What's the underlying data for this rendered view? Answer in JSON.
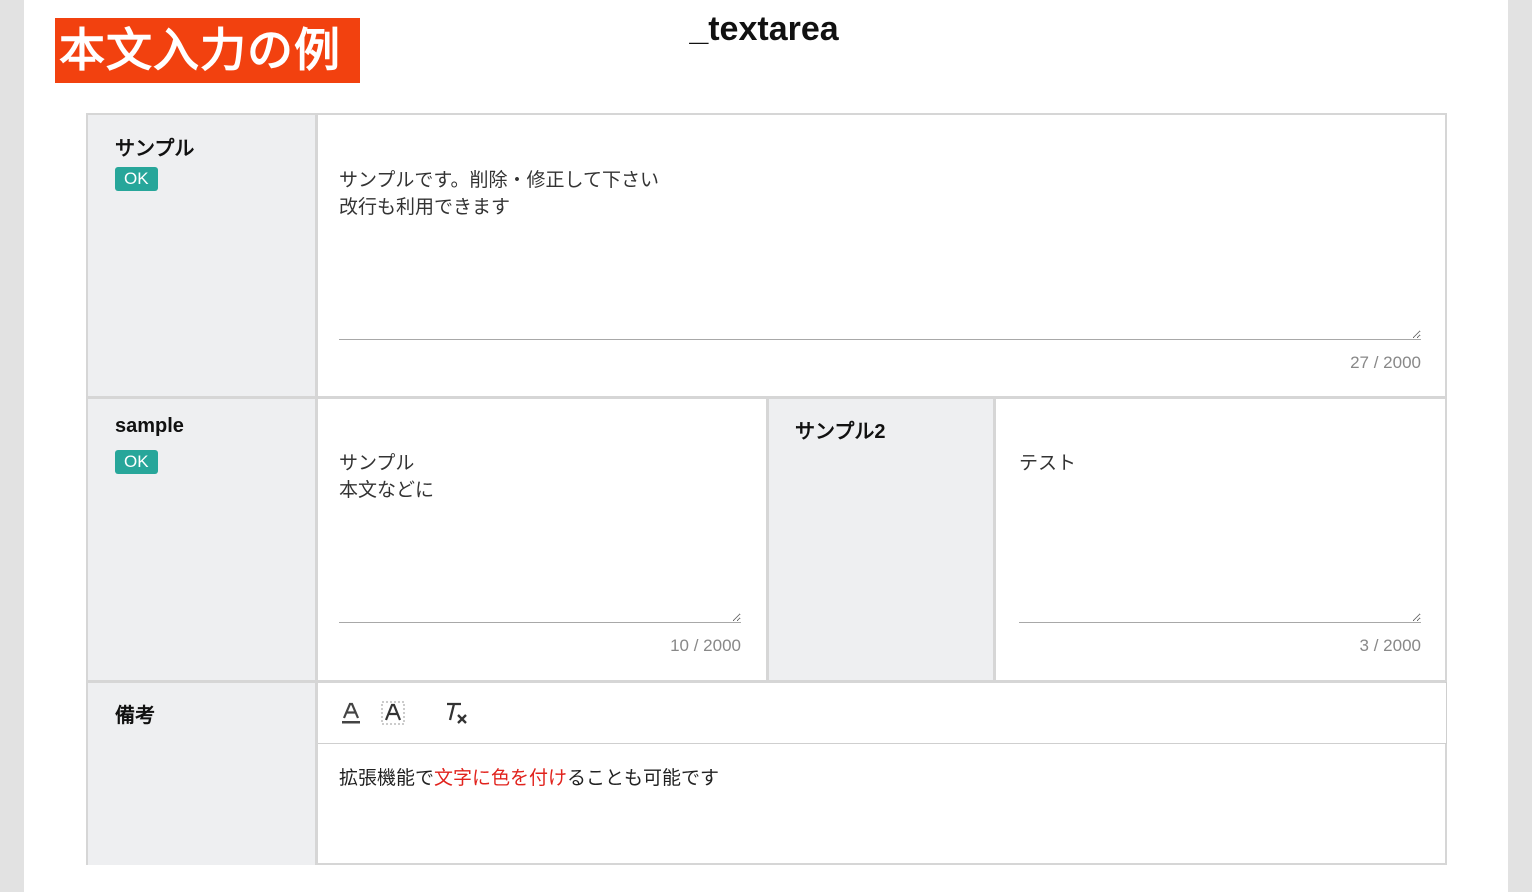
{
  "banner": "本文入力の例",
  "page_title": "_textarea",
  "rows": [
    {
      "label": "サンプル",
      "badge": "OK",
      "textarea_value": "サンプルです。削除・修正して下さい\n改行も利用できます",
      "counter": "27 / 2000"
    },
    {
      "label": "sample",
      "badge": "OK",
      "textarea_value": "サンプル\n本文などに",
      "counter": "10 / 2000",
      "label2": "サンプル2",
      "textarea2_value": "テスト",
      "counter2": "3 / 2000"
    }
  ],
  "remarks": {
    "label": "備考",
    "toolbar": [
      "font-color-icon",
      "highlight-color-icon",
      "clear-format-icon"
    ],
    "text_before": "拡張機能で",
    "text_red": "文字に色を付け",
    "text_after": "ることも可能です",
    "red_color": "#e1231d"
  },
  "colors": {
    "banner_bg": "#f2410f",
    "badge_bg": "#27a69a",
    "label_bg": "#eeeff1"
  }
}
